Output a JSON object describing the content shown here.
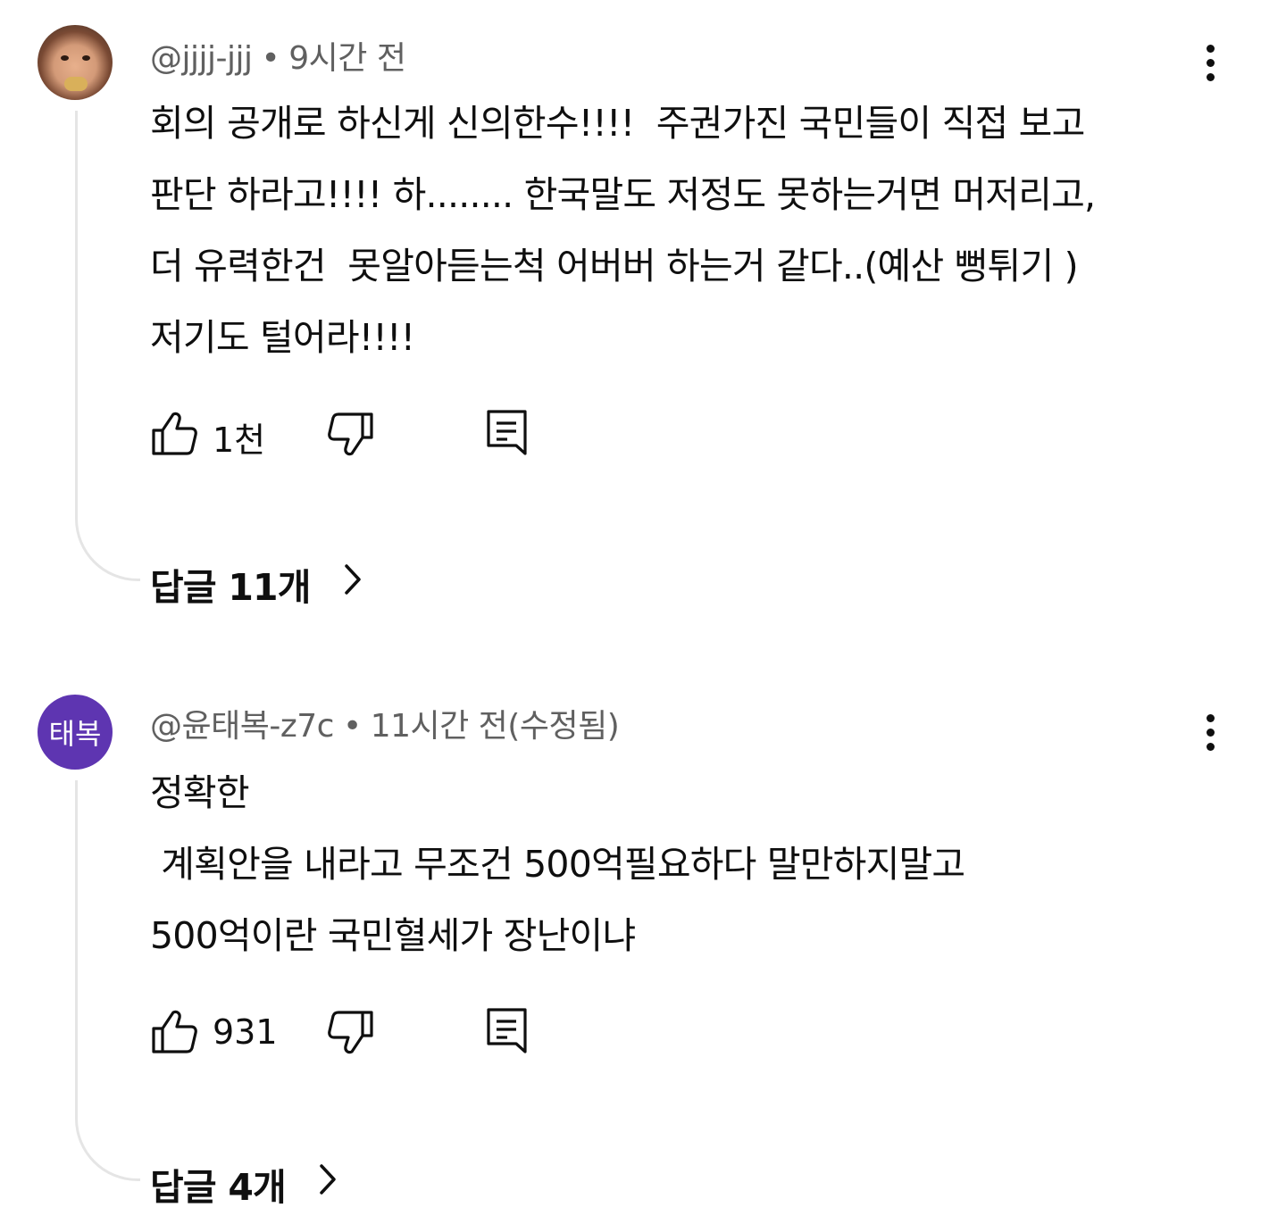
{
  "comments": [
    {
      "handle": "@jjjj-jjj",
      "separator": "•",
      "time": "9시간 전",
      "lines": [
        "회의 공개로 하신게 신의한수!!!!  주권가진 국민들이 직접 보고",
        "판단 하라고!!!! 하........ 한국말도 저정도 못하는거면 머저리고,",
        "더 유력한건  못알아듣는척 어버버 하는거 같다..(예산 뻥튀기 )",
        "저기도 털어라!!!!"
      ],
      "likes": "1천",
      "replies_label": "답글 11개",
      "avatar_icon": "child-photo-avatar"
    },
    {
      "handle": "@윤태복-z7c",
      "separator": "•",
      "time": "11시간 전(수정됨)",
      "avatar_text": "태복",
      "avatar_color": "#5e35b1",
      "lines": [
        "정확한",
        " 계획안을 내라고 무조건 500억필요하다 말만하지말고",
        "500억이란 국민혈세가 장난이냐"
      ],
      "likes": "931",
      "replies_label": "답글 4개"
    }
  ],
  "icons": {
    "like": "thumbs-up-icon",
    "dislike": "thumbs-down-icon",
    "reply": "comment-icon",
    "more": "more-vert-icon",
    "chevron": "chevron-right-icon"
  }
}
